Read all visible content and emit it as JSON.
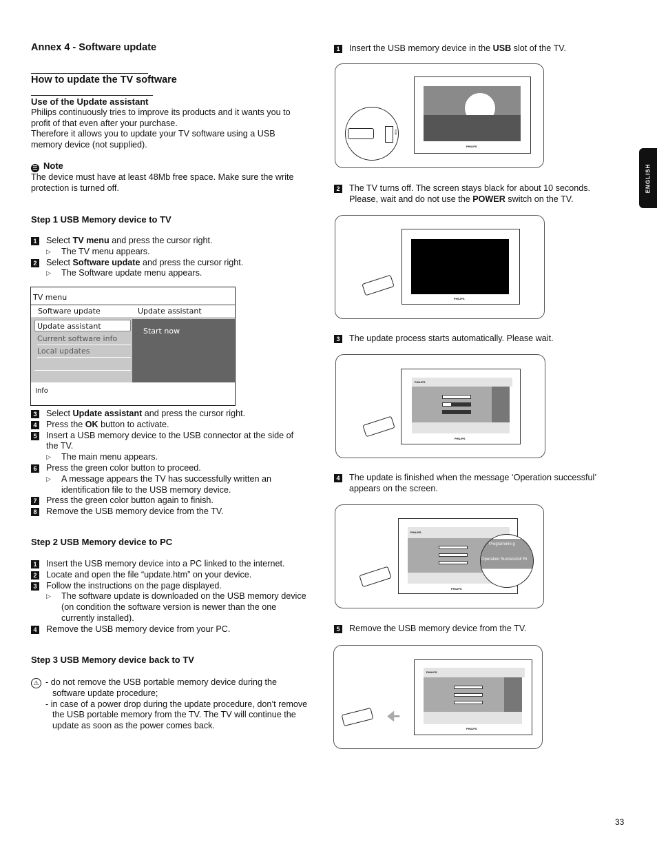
{
  "annex_title": "Annex 4 - Software update",
  "section_title": "How to update the TV software",
  "use": {
    "heading": "Use of the Update assistant",
    "lines": [
      "Philips continuously tries to improve its products and it wants you to",
      "profit of that even after your purchase.",
      "Therefore it allows you to update your TV software using a USB",
      "memory device (not supplied)."
    ]
  },
  "note": {
    "label": "Note",
    "lines": [
      "The device must have at least 48Mb free space. Make sure the write",
      "protection is turned off."
    ]
  },
  "step1": {
    "heading": "Step 1 USB Memory device to TV",
    "i1": {
      "n": "1",
      "pre": "Select ",
      "b": "TV menu",
      "post": " and press the cursor right.",
      "sub": "The TV menu appears."
    },
    "i2": {
      "n": "2",
      "pre": "Select ",
      "b": "Software update",
      "post": " and press the cursor right.",
      "sub": "The Software update menu appears."
    },
    "i3": {
      "n": "3",
      "pre": "Select ",
      "b": "Update assistant",
      "post": " and press the cursor right."
    },
    "i4": {
      "n": "4",
      "pre": "Press the ",
      "b": "OK",
      "post": " button to activate."
    },
    "i5": {
      "n": "5",
      "l1": "Insert a USB memory device to the USB connector at the side of",
      "l2": "the TV.",
      "sub": "The main menu appears."
    },
    "i6": {
      "n": "6",
      "text": "Press the green color button to proceed.",
      "sub1": "A message appears the TV has successfully written an",
      "sub2": "identification file to the USB memory device."
    },
    "i7": {
      "n": "7",
      "text": "Press the green color button again to finish."
    },
    "i8": {
      "n": "8",
      "text": "Remove the USB memory device from the TV."
    }
  },
  "menu": {
    "title": "TV menu",
    "col1": "Software update",
    "col2": "Update assistant",
    "items": [
      "Update assistant",
      "Current software info",
      "Local updates"
    ],
    "right": "Start now",
    "info": "Info"
  },
  "step2": {
    "heading": "Step 2 USB Memory device to PC",
    "i1": {
      "n": "1",
      "text": "Insert the USB memory device into a PC linked to the internet."
    },
    "i2": {
      "n": "2",
      "text": "Locate and open the file “update.htm” on your device."
    },
    "i3": {
      "n": "3",
      "text": "Follow the instructions on the page displayed.",
      "sub1": "The software update is downloaded on the USB memory device",
      "sub2": "(on condition the software version is newer than the one",
      "sub3": "currently installed)."
    },
    "i4": {
      "n": "4",
      "text": "Remove the USB memory device from your PC."
    }
  },
  "step3": {
    "heading": "Step 3 USB Memory device back to TV",
    "lines": [
      "- do not remove the USB portable memory device during the",
      "software update procedure;",
      "- in case of a power drop during the update procedure, don’t remove",
      "the USB portable memory from the TV. The TV will continue the",
      "update as soon as the power comes back."
    ]
  },
  "right": {
    "r1": {
      "n": "1",
      "pre": "Insert the USB memory device in the ",
      "b": "USB",
      "post": " slot of the TV."
    },
    "r2": {
      "n": "2",
      "l1": "The TV turns off. The screen stays black for about 10 seconds.",
      "pre": "Please, wait and do not use the ",
      "b": "POWER",
      "post": " switch on the TV."
    },
    "r3": {
      "n": "3",
      "text": "The update process starts automatically. Please wait."
    },
    "r4": {
      "n": "4",
      "l1": "The update is finished when the message ‘Operation successful’",
      "l2": "appears on the screen."
    },
    "r5": {
      "n": "5",
      "text": "Remove the USB memory device from the TV."
    }
  },
  "illus": {
    "brand": "PHILIPS",
    "usb": "USB",
    "programming": "Programmin g",
    "success": "Operation Successful! Ri"
  },
  "side_tab": "ENGLISH",
  "page_number": "33"
}
